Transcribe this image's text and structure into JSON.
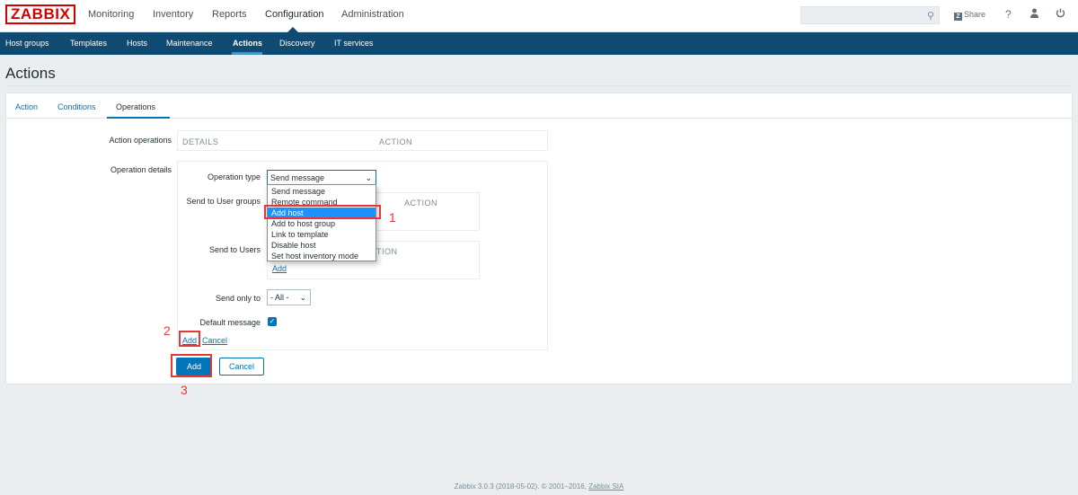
{
  "topbar": {
    "logo": "ZABBIX",
    "menu": [
      "Monitoring",
      "Inventory",
      "Reports",
      "Configuration",
      "Administration"
    ],
    "active_menu": "Configuration",
    "search_placeholder": "",
    "share_label": "Share",
    "share_icon_letter": "Z",
    "help_icon": "?",
    "user_icon": "user-icon",
    "power_icon": "power-icon"
  },
  "subnav": {
    "items": [
      "Host groups",
      "Templates",
      "Hosts",
      "Maintenance",
      "Actions",
      "Discovery",
      "IT services"
    ],
    "active": "Actions"
  },
  "page": {
    "title": "Actions"
  },
  "tabs": {
    "items": [
      "Action",
      "Conditions",
      "Operations"
    ],
    "active": "Operations"
  },
  "form": {
    "action_operations_label": "Action operations",
    "details_header": "DETAILS",
    "action_header": "ACTION",
    "operation_details_label": "Operation details",
    "operation_type_label": "Operation type",
    "operation_type_value": "Send message",
    "operation_type_options": [
      "Send message",
      "Remote command",
      "Add host",
      "Add to host group",
      "Link to template",
      "Disable host",
      "Set host inventory mode"
    ],
    "operation_type_highlighted": "Add host",
    "send_to_groups_label": "Send to User groups",
    "groups_action_header": "ACTION",
    "send_to_users_label": "Send to Users",
    "users_action_header": "TION",
    "users_add_link": "Add",
    "send_only_to_label": "Send only to",
    "send_only_to_value": "- All -",
    "default_message_label": "Default message",
    "default_message_checked": true,
    "op_add_link": "Add",
    "op_cancel_link": "Cancel"
  },
  "buttons": {
    "add": "Add",
    "cancel": "Cancel"
  },
  "annotations": {
    "n1": "1",
    "n2": "2",
    "n3": "3",
    "color": "#e53935"
  },
  "footer": {
    "text": "Zabbix 3.0.3 (2018-05-02). © 2001–2016,",
    "link": "Zabbix SIA"
  },
  "colors": {
    "nav": "#0e4a71",
    "accent": "#0275b8",
    "logo": "#d40000"
  }
}
